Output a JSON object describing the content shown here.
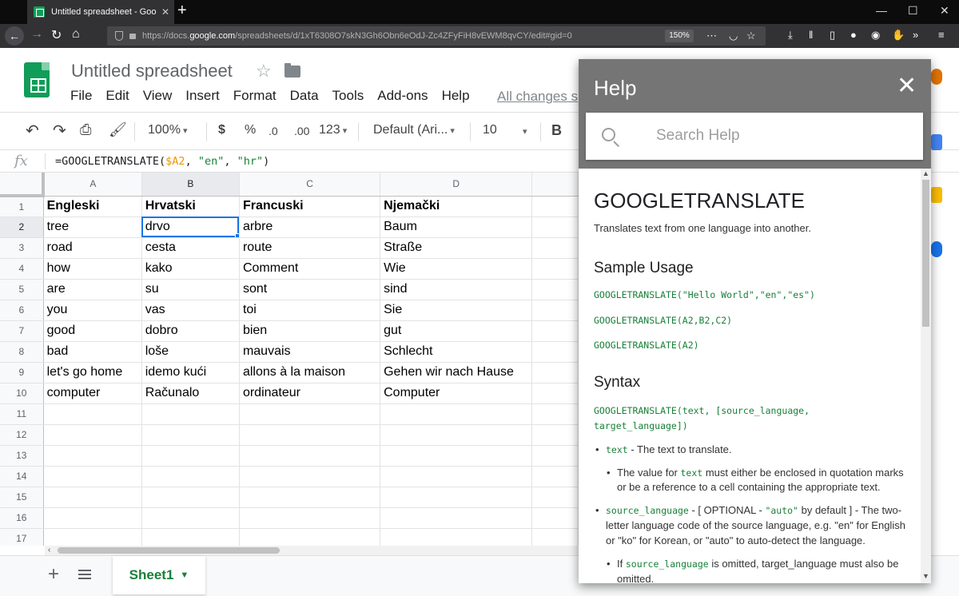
{
  "browser": {
    "tab_title": "Untitled spreadsheet - Google S",
    "url_prefix": "https://docs.",
    "url_host": "google.com",
    "url_path": "/spreadsheets/d/1xT6308O7skN3Gh6Obn6eOdJ-Zc4ZFyFiH8vEWM8qvCY/edit#gid=0",
    "zoom": "150%"
  },
  "app": {
    "title": "Untitled spreadsheet",
    "menus": [
      "File",
      "Edit",
      "View",
      "Insert",
      "Format",
      "Data",
      "Tools",
      "Add-ons",
      "Help"
    ],
    "saved_status": "All changes s"
  },
  "toolbar": {
    "zoom": "100%",
    "currency": "$",
    "percent": "%",
    "decrease_decimals": ".0",
    "increase_decimals": ".00",
    "more_formats": "123",
    "font": "Default (Ari...",
    "font_size": "10",
    "bold": "B"
  },
  "formula_bar": {
    "fx": "fx",
    "prefix": "=GOOGLETRANSLATE(",
    "ref": "$A2",
    "sep1": ", ",
    "arg1": "\"en\"",
    "sep2": ", ",
    "arg2": "\"hr\"",
    "suffix": ")"
  },
  "grid": {
    "columns": [
      "A",
      "B",
      "C",
      "D"
    ],
    "rows": [
      [
        "Engleski",
        "Hrvatski",
        "Francuski",
        "Njemački"
      ],
      [
        "tree",
        "drvo",
        "arbre",
        "Baum"
      ],
      [
        "road",
        "cesta",
        "route",
        "Straße"
      ],
      [
        "how",
        "kako",
        "Comment",
        "Wie"
      ],
      [
        "are",
        "su",
        "sont",
        "sind"
      ],
      [
        "you",
        "vas",
        "toi",
        "Sie"
      ],
      [
        "good",
        "dobro",
        "bien",
        "gut"
      ],
      [
        "bad",
        "loše",
        "mauvais",
        "Schlecht"
      ],
      [
        "let's go home",
        "idemo kući",
        "allons à la maison",
        "Gehen wir nach Hause"
      ],
      [
        "computer",
        "Računalo",
        "ordinateur",
        "Computer"
      ],
      [
        "",
        "",
        "",
        ""
      ],
      [
        "",
        "",
        "",
        ""
      ],
      [
        "",
        "",
        "",
        ""
      ],
      [
        "",
        "",
        "",
        ""
      ],
      [
        "",
        "",
        "",
        ""
      ],
      [
        "",
        "",
        "",
        ""
      ],
      [
        "",
        "",
        "",
        ""
      ]
    ],
    "row_numbers": [
      "1",
      "2",
      "3",
      "4",
      "5",
      "6",
      "7",
      "8",
      "9",
      "10",
      "11",
      "12",
      "13",
      "14",
      "15",
      "16",
      "17"
    ],
    "active_cell": "B2"
  },
  "sheets": {
    "tab_label": "Sheet1"
  },
  "help_panel": {
    "title": "Help",
    "search_placeholder": "Search Help",
    "function_name": "GOOGLETRANSLATE",
    "description": "Translates text from one language into another.",
    "sample_usage_heading": "Sample Usage",
    "samples": [
      "GOOGLETRANSLATE(\"Hello World\",\"en\",\"es\")",
      "GOOGLETRANSLATE(A2,B2,C2)",
      "GOOGLETRANSLATE(A2)"
    ],
    "syntax_heading": "Syntax",
    "syntax": "GOOGLETRANSLATE(text, [source_language, target_language])",
    "params": {
      "text_name": "text",
      "text_desc": " - The text to translate.",
      "text_sub_1": "The value for ",
      "text_sub_code": "text",
      "text_sub_2": " must either be enclosed in quotation marks or be a reference to a cell containing the appropriate text.",
      "src_name": "source_language",
      "src_desc_1": " - [ OPTIONAL - ",
      "src_default": "\"auto\"",
      "src_desc_2": " by default ] - The two-letter language code of the source language, e.g. \"en\" for English or \"ko\" for Korean, or \"auto\" to auto-detect the language.",
      "src_sub_1": "If ",
      "src_sub_code": "source_language",
      "src_sub_2": " is omitted, target_language must also be omitted."
    }
  },
  "colors": {
    "sheets_green": "#0f9d58",
    "active_blue": "#1a73e8",
    "help_header": "#757575",
    "code_green": "#188038"
  }
}
